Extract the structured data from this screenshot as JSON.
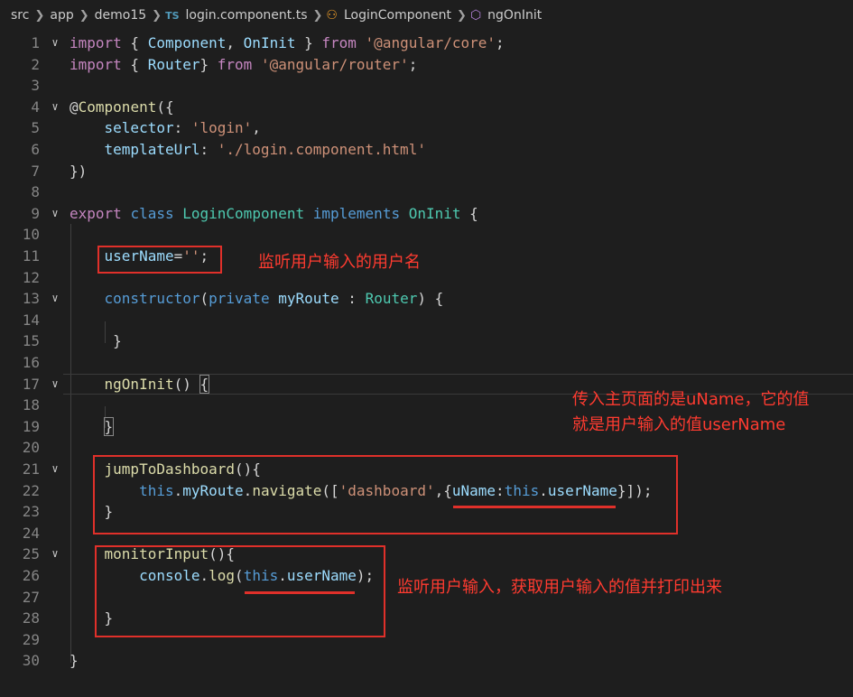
{
  "breadcrumb": {
    "items": [
      "src",
      "app",
      "demo15"
    ],
    "file_badge": "TS",
    "file": "login.component.ts",
    "class_name": "LoginComponent",
    "method_name": "ngOnInit",
    "icons": {
      "separator": "chevron-right-icon",
      "class": "class-symbol-icon",
      "method": "method-cube-icon"
    }
  },
  "colors": {
    "background": "#1e1e1e",
    "keyword": "#569cd6",
    "control_keyword": "#c586c0",
    "string": "#ce9178",
    "class": "#4ec9b0",
    "function": "#dcdcaa",
    "variable": "#9cdcfe",
    "annotation": "#e0302a"
  },
  "code_lines": [
    {
      "n": "1",
      "fold": true,
      "tokens": [
        [
          "kw2",
          "import"
        ],
        [
          "pun",
          " { "
        ],
        [
          "var",
          "Component"
        ],
        [
          "pun",
          ", "
        ],
        [
          "var",
          "OnInit"
        ],
        [
          "pun",
          " } "
        ],
        [
          "kw2",
          "from"
        ],
        [
          "pun",
          " "
        ],
        [
          "str",
          "'@angular/core'"
        ],
        [
          "pun",
          ";"
        ]
      ]
    },
    {
      "n": "2",
      "tokens": [
        [
          "kw2",
          "import"
        ],
        [
          "pun",
          " { "
        ],
        [
          "var",
          "Router"
        ],
        [
          "pun",
          "} "
        ],
        [
          "kw2",
          "from"
        ],
        [
          "pun",
          " "
        ],
        [
          "str",
          "'@angular/router'"
        ],
        [
          "pun",
          ";"
        ]
      ]
    },
    {
      "n": "3",
      "tokens": []
    },
    {
      "n": "4",
      "fold": true,
      "tokens": [
        [
          "pun",
          "@"
        ],
        [
          "fn",
          "Component"
        ],
        [
          "pun",
          "({"
        ]
      ]
    },
    {
      "n": "5",
      "tokens": [
        [
          "pun",
          "    "
        ],
        [
          "var",
          "selector"
        ],
        [
          "pun",
          ": "
        ],
        [
          "str",
          "'login'"
        ],
        [
          "pun",
          ","
        ]
      ]
    },
    {
      "n": "6",
      "tokens": [
        [
          "pun",
          "    "
        ],
        [
          "var",
          "templateUrl"
        ],
        [
          "pun",
          ": "
        ],
        [
          "str",
          "'./login.component.html'"
        ]
      ]
    },
    {
      "n": "7",
      "tokens": [
        [
          "pun",
          "})"
        ]
      ]
    },
    {
      "n": "8",
      "tokens": []
    },
    {
      "n": "9",
      "fold": true,
      "tokens": [
        [
          "kw2",
          "export"
        ],
        [
          "pun",
          " "
        ],
        [
          "kw",
          "class"
        ],
        [
          "pun",
          " "
        ],
        [
          "cls",
          "LoginComponent"
        ],
        [
          "pun",
          " "
        ],
        [
          "kw",
          "implements"
        ],
        [
          "pun",
          " "
        ],
        [
          "cls",
          "OnInit"
        ],
        [
          "pun",
          " {"
        ]
      ]
    },
    {
      "n": "10",
      "tokens": []
    },
    {
      "n": "11",
      "tokens": [
        [
          "pun",
          "    "
        ],
        [
          "var",
          "userName"
        ],
        [
          "pun",
          "="
        ],
        [
          "str",
          "''"
        ],
        [
          "pun",
          ";"
        ]
      ]
    },
    {
      "n": "12",
      "tokens": []
    },
    {
      "n": "13",
      "fold": true,
      "tokens": [
        [
          "pun",
          "    "
        ],
        [
          "kw",
          "constructor"
        ],
        [
          "pun",
          "("
        ],
        [
          "kw",
          "private"
        ],
        [
          "pun",
          " "
        ],
        [
          "var",
          "myRoute"
        ],
        [
          "pun",
          " : "
        ],
        [
          "cls",
          "Router"
        ],
        [
          "pun",
          ") {"
        ]
      ]
    },
    {
      "n": "14",
      "tokens": []
    },
    {
      "n": "15",
      "tokens": [
        [
          "pun",
          "     }"
        ]
      ]
    },
    {
      "n": "16",
      "tokens": []
    },
    {
      "n": "17",
      "fold": true,
      "current": true,
      "tokens": [
        [
          "pun",
          "    "
        ],
        [
          "fn",
          "ngOnInit"
        ],
        [
          "pun",
          "() "
        ],
        [
          "brk",
          "{"
        ]
      ]
    },
    {
      "n": "18",
      "tokens": []
    },
    {
      "n": "19",
      "tokens": [
        [
          "pun",
          "    "
        ],
        [
          "brk",
          "}"
        ]
      ]
    },
    {
      "n": "20",
      "tokens": []
    },
    {
      "n": "21",
      "fold": true,
      "tokens": [
        [
          "pun",
          "    "
        ],
        [
          "fn",
          "jumpToDashboard"
        ],
        [
          "pun",
          "(){"
        ]
      ]
    },
    {
      "n": "22",
      "tokens": [
        [
          "pun",
          "        "
        ],
        [
          "kw",
          "this"
        ],
        [
          "pun",
          "."
        ],
        [
          "var",
          "myRoute"
        ],
        [
          "pun",
          "."
        ],
        [
          "fn",
          "navigate"
        ],
        [
          "pun",
          "(["
        ],
        [
          "str",
          "'dashboard'"
        ],
        [
          "pun",
          ",{"
        ],
        [
          "var",
          "uName"
        ],
        [
          "pun",
          ":"
        ],
        [
          "kw",
          "this"
        ],
        [
          "pun",
          "."
        ],
        [
          "var",
          "userName"
        ],
        [
          "pun",
          "}]);"
        ]
      ]
    },
    {
      "n": "23",
      "tokens": [
        [
          "pun",
          "    }"
        ]
      ]
    },
    {
      "n": "24",
      "tokens": []
    },
    {
      "n": "25",
      "fold": true,
      "tokens": [
        [
          "pun",
          "    "
        ],
        [
          "fn",
          "monitorInput"
        ],
        [
          "pun",
          "(){"
        ]
      ]
    },
    {
      "n": "26",
      "tokens": [
        [
          "pun",
          "        "
        ],
        [
          "var",
          "console"
        ],
        [
          "pun",
          "."
        ],
        [
          "fn",
          "log"
        ],
        [
          "pun",
          "("
        ],
        [
          "kw",
          "this"
        ],
        [
          "pun",
          "."
        ],
        [
          "var",
          "userName"
        ],
        [
          "pun",
          ");"
        ]
      ]
    },
    {
      "n": "27",
      "tokens": []
    },
    {
      "n": "28",
      "tokens": [
        [
          "pun",
          "    }"
        ]
      ]
    },
    {
      "n": "29",
      "tokens": []
    },
    {
      "n": "30",
      "tokens": [
        [
          "pun",
          "}"
        ]
      ]
    }
  ],
  "annotations": {
    "note_username": "监听用户输入的用户名",
    "note_uname_line1": "传入主页面的是uName，它的值",
    "note_uname_line2": "就是用户输入的值userName",
    "note_monitor": "监听用户输入，获取用户输入的值并打印出来"
  }
}
